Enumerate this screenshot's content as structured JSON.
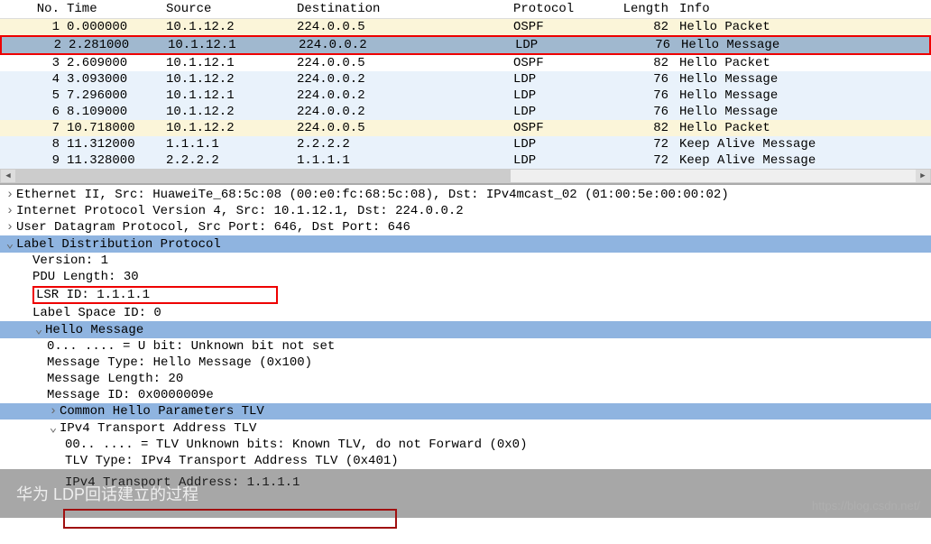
{
  "columns": {
    "no": "No.",
    "time": "Time",
    "src": "Source",
    "dst": "Destination",
    "proto": "Protocol",
    "len": "Length",
    "info": "Info"
  },
  "packets": [
    {
      "no": "1",
      "time": "0.000000",
      "src": "10.1.12.2",
      "dst": "224.0.0.5",
      "proto": "OSPF",
      "len": "82",
      "info": "Hello Packet",
      "cls": "bg-cream"
    },
    {
      "no": "2",
      "time": "2.281000",
      "src": "10.1.12.1",
      "dst": "224.0.0.2",
      "proto": "LDP",
      "len": "76",
      "info": "Hello Message",
      "cls": "bg-sel",
      "boxed": true
    },
    {
      "no": "3",
      "time": "2.609000",
      "src": "10.1.12.1",
      "dst": "224.0.0.5",
      "proto": "OSPF",
      "len": "82",
      "info": "Hello Packet",
      "cls": "bg-white"
    },
    {
      "no": "4",
      "time": "3.093000",
      "src": "10.1.12.2",
      "dst": "224.0.0.2",
      "proto": "LDP",
      "len": "76",
      "info": "Hello Message",
      "cls": "bg-light"
    },
    {
      "no": "5",
      "time": "7.296000",
      "src": "10.1.12.1",
      "dst": "224.0.0.2",
      "proto": "LDP",
      "len": "76",
      "info": "Hello Message",
      "cls": "bg-light"
    },
    {
      "no": "6",
      "time": "8.109000",
      "src": "10.1.12.2",
      "dst": "224.0.0.2",
      "proto": "LDP",
      "len": "76",
      "info": "Hello Message",
      "cls": "bg-light"
    },
    {
      "no": "7",
      "time": "10.718000",
      "src": "10.1.12.2",
      "dst": "224.0.0.5",
      "proto": "OSPF",
      "len": "82",
      "info": "Hello Packet",
      "cls": "bg-cream"
    },
    {
      "no": "8",
      "time": "11.312000",
      "src": "1.1.1.1",
      "dst": "2.2.2.2",
      "proto": "LDP",
      "len": "72",
      "info": "Keep Alive Message",
      "cls": "bg-light"
    },
    {
      "no": "9",
      "time": "11.328000",
      "src": "2.2.2.2",
      "dst": "1.1.1.1",
      "proto": "LDP",
      "len": "72",
      "info": "Keep Alive Message",
      "cls": "bg-light"
    }
  ],
  "detail": {
    "eth": "Ethernet II, Src: HuaweiTe_68:5c:08 (00:e0:fc:68:5c:08), Dst: IPv4mcast_02 (01:00:5e:00:00:02)",
    "ip": "Internet Protocol Version 4, Src: 10.1.12.1, Dst: 224.0.0.2",
    "udp": "User Datagram Protocol, Src Port: 646, Dst Port: 646",
    "ldp": "Label Distribution Protocol",
    "ver": "Version: 1",
    "pdu": "PDU Length: 30",
    "lsr": "LSR ID: 1.1.1.1",
    "lbl": "Label Space ID: 0",
    "hello": "Hello Message",
    "ubit": "0... .... = U bit: Unknown bit not set",
    "mtype": "Message Type: Hello Message (0x100)",
    "mlen": "Message Length: 20",
    "mid": "Message ID: 0x0000009e",
    "chp": "Common Hello Parameters TLV",
    "tlv": "IPv4 Transport Address TLV",
    "tlvbits": "00.. .... = TLV Unknown bits: Known TLV, do not Forward (0x0)",
    "tlvtype": "TLV Type: IPv4 Transport Address TLV (0x401)",
    "taddr": "IPv4 Transport Address: 1.1.1.1"
  },
  "overlay_text": "华为 LDP回话建立的过程",
  "watermark": "https://blog.csdn.net/"
}
